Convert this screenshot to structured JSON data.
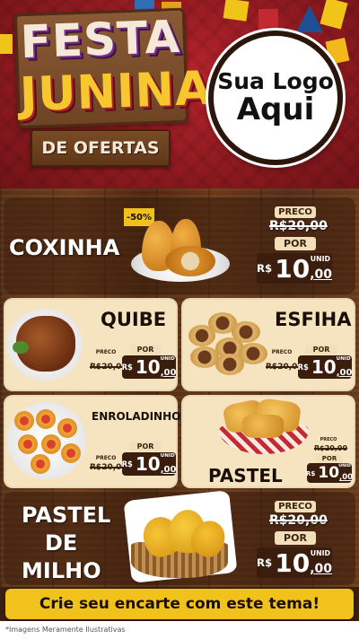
{
  "header": {
    "sign_line1": "FESTA",
    "sign_line2": "JUNINA",
    "sign_sub": "DE OFERTAS",
    "logo_line1": "Sua Logo",
    "logo_line2": "Aqui"
  },
  "products": {
    "coxinha": {
      "name": "COXINHA",
      "discount": "-50%",
      "price_label": "PRECO",
      "old_price": "R$20,00",
      "por_label": "POR",
      "currency": "R$",
      "price_int": "10",
      "price_dec": ",00",
      "unit": "UNID"
    },
    "quibe": {
      "name": "QUIBE",
      "price_label": "PRECO",
      "old_price": "R$20,00",
      "por_label": "POR",
      "currency": "R$",
      "price_int": "10",
      "price_dec": ",00",
      "unit": "UNID"
    },
    "esfiha": {
      "name": "ESFIHA",
      "price_label": "PRECO",
      "old_price": "R$20,00",
      "por_label": "POR",
      "currency": "R$",
      "price_int": "10",
      "price_dec": ",00",
      "unit": "UNID"
    },
    "enroladinho": {
      "name": "ENROLADINHO",
      "price_label": "PRECO",
      "old_price": "R$20,00",
      "por_label": "POR",
      "currency": "R$",
      "price_int": "10",
      "price_dec": ",00",
      "unit": "UNID"
    },
    "pastel": {
      "name": "PASTEL",
      "price_label": "PRECO",
      "old_price": "R$20,00",
      "por_label": "POR",
      "currency": "R$",
      "price_int": "10",
      "price_dec": ",00",
      "unit": "UNID"
    },
    "pastel_milho": {
      "name_line1": "PASTEL",
      "name_line2": "DE",
      "name_line3": "MILHO",
      "price_label": "PRECO",
      "old_price": "R$20,00",
      "por_label": "POR",
      "currency": "R$",
      "price_int": "10",
      "price_dec": ",00",
      "unit": "UNID"
    }
  },
  "cta": {
    "label": "Crie seu encarte com este tema!"
  },
  "footnote": "*Imagens Meramente Ilustrativas",
  "colors": {
    "header_red": "#8e1a20",
    "wood_brown": "#5a3318",
    "card_cream": "#f6e3c0",
    "price_dark": "#3a1d0c",
    "accent_yellow": "#f2c21c"
  }
}
